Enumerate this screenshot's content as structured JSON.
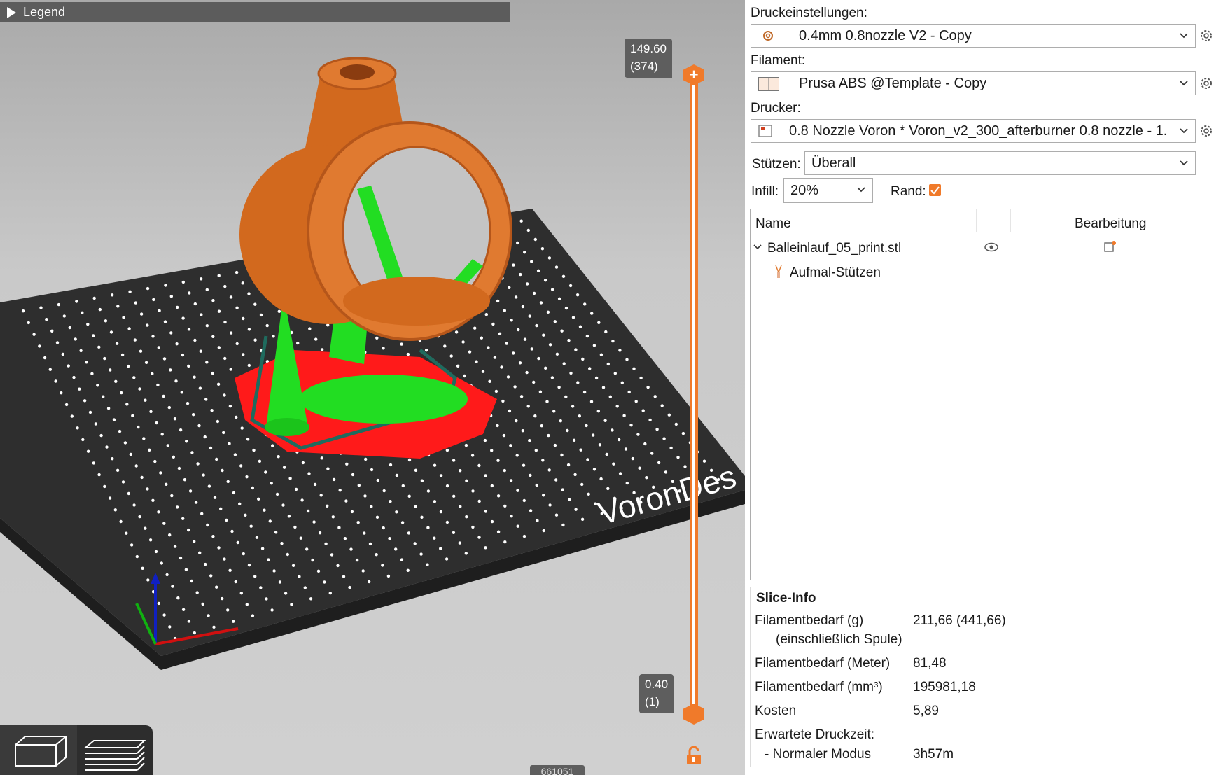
{
  "viewport": {
    "legend_label": "Legend",
    "top_value": "149.60",
    "top_layer": "(374)",
    "bottom_value": "0.40",
    "bottom_layer": "(1)",
    "bed_text": "VoronDes",
    "status_number": "661051"
  },
  "settings": {
    "print_label": "Druckeinstellungen:",
    "print_value": "0.4mm 0.8nozzle V2 - Copy",
    "filament_label": "Filament:",
    "filament_value": "Prusa ABS @Template - Copy",
    "printer_label": "Drucker:",
    "printer_value": "0.8 Nozzle Voron  * Voron_v2_300_afterburner 0.8 nozzle - 1. ...",
    "supports_label": "Stützen:",
    "supports_value": "Überall",
    "infill_label": "Infill:",
    "infill_value": "20%",
    "brim_label": "Rand:",
    "brim_checked": true
  },
  "objects": {
    "col_name": "Name",
    "col_edit": "Bearbeitung",
    "items": [
      {
        "name": "Balleinlauf_05_print.stl"
      },
      {
        "name": "Aufmal-Stützen"
      }
    ]
  },
  "slice_info": {
    "title": "Slice-Info",
    "rows": [
      {
        "label": "Filamentbedarf (g)",
        "value": "211,66 (441,66)"
      },
      {
        "label": "(einschließlich Spule)",
        "value": ""
      },
      {
        "label": "Filamentbedarf (Meter)",
        "value": "81,48"
      },
      {
        "label": "Filamentbedarf (mm³)",
        "value": "195981,18"
      },
      {
        "label": "Kosten",
        "value": "5,89"
      },
      {
        "label": "Erwartete Druckzeit:",
        "value": ""
      },
      {
        "label": "- Normaler Modus",
        "value": "3h57m"
      }
    ]
  },
  "colors": {
    "accent": "#f07a2a",
    "model": "#d2691e",
    "support": "#22dd22",
    "brim": "#ff1a1a",
    "bed": "#2e2e2e"
  }
}
